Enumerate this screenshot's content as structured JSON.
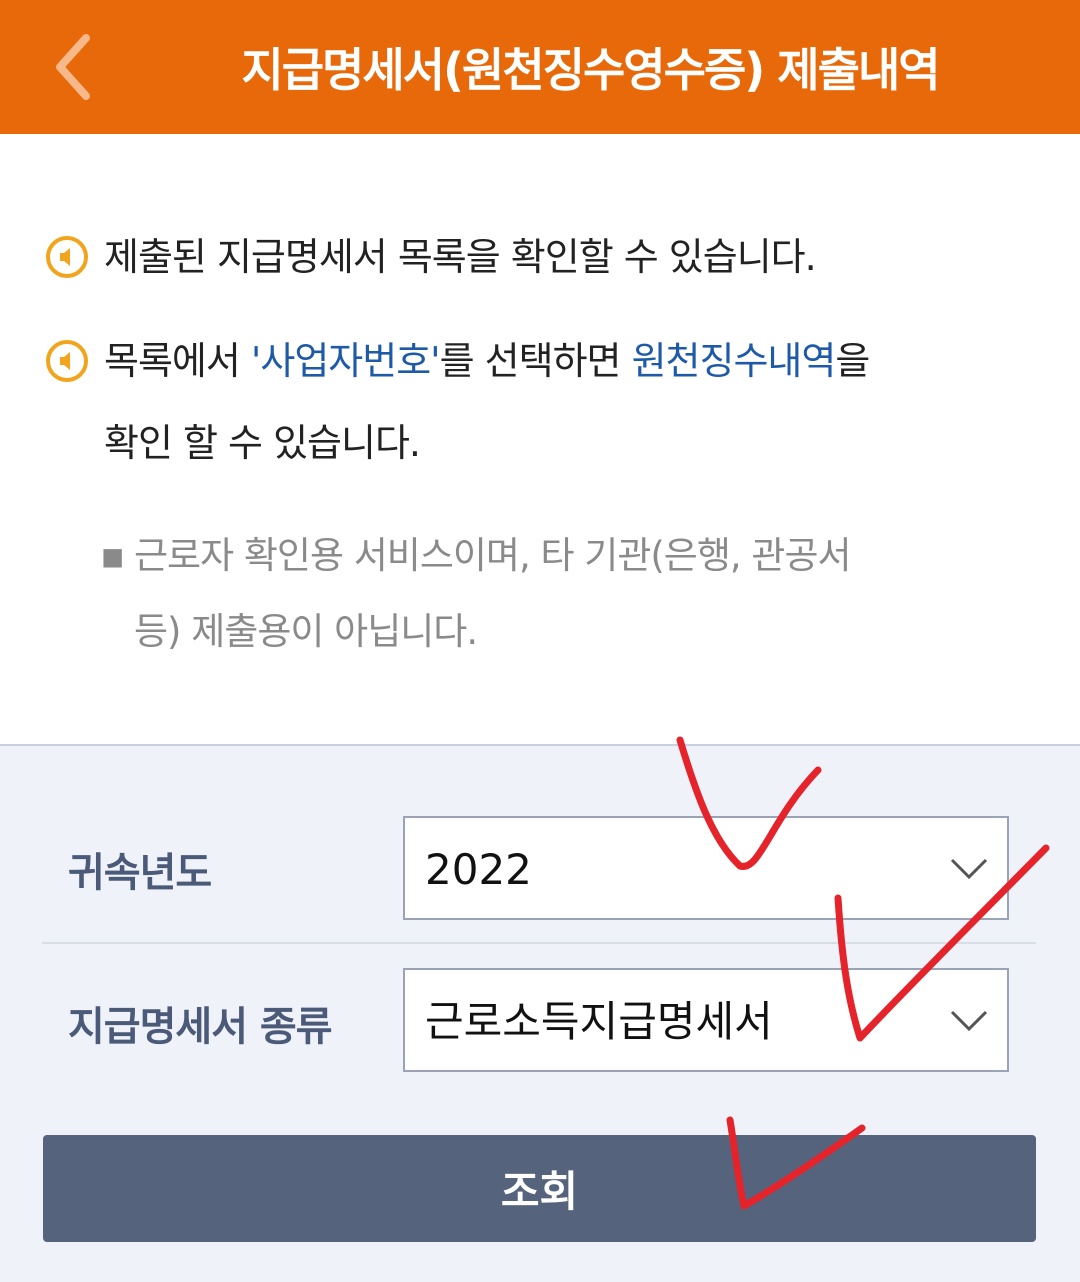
{
  "header": {
    "title": "지급명세서(원천징수영수증) 제출내역",
    "back_icon": "chevron-left-icon"
  },
  "notices": [
    {
      "icon": "speaker-icon",
      "text": "제출된 지급명세서 목록을 확인할 수 있습니다."
    },
    {
      "icon": "speaker-icon",
      "part1": "목록에서 ",
      "link1": "'사업자번호'",
      "part2": "를 선택하면 ",
      "link2": "원천징수내역",
      "part3": "을",
      "line2": "확인 할 수 있습니다."
    }
  ],
  "note": {
    "bullet": "▪",
    "line1": "근로자 확인용 서비스이며, 타 기관(은행, 관공서",
    "line2": "등) 제출용이 아닙니다."
  },
  "form": {
    "year_label": "귀속년도",
    "year_value": "2022",
    "type_label": "지급명세서 종류",
    "type_value": "근로소득지급명세서",
    "submit_label": "조회"
  },
  "colors": {
    "header_bg": "#e8690a",
    "link_blue": "#1f5aa9",
    "button_bg": "#56637c",
    "annotation_red": "#e5232b"
  }
}
